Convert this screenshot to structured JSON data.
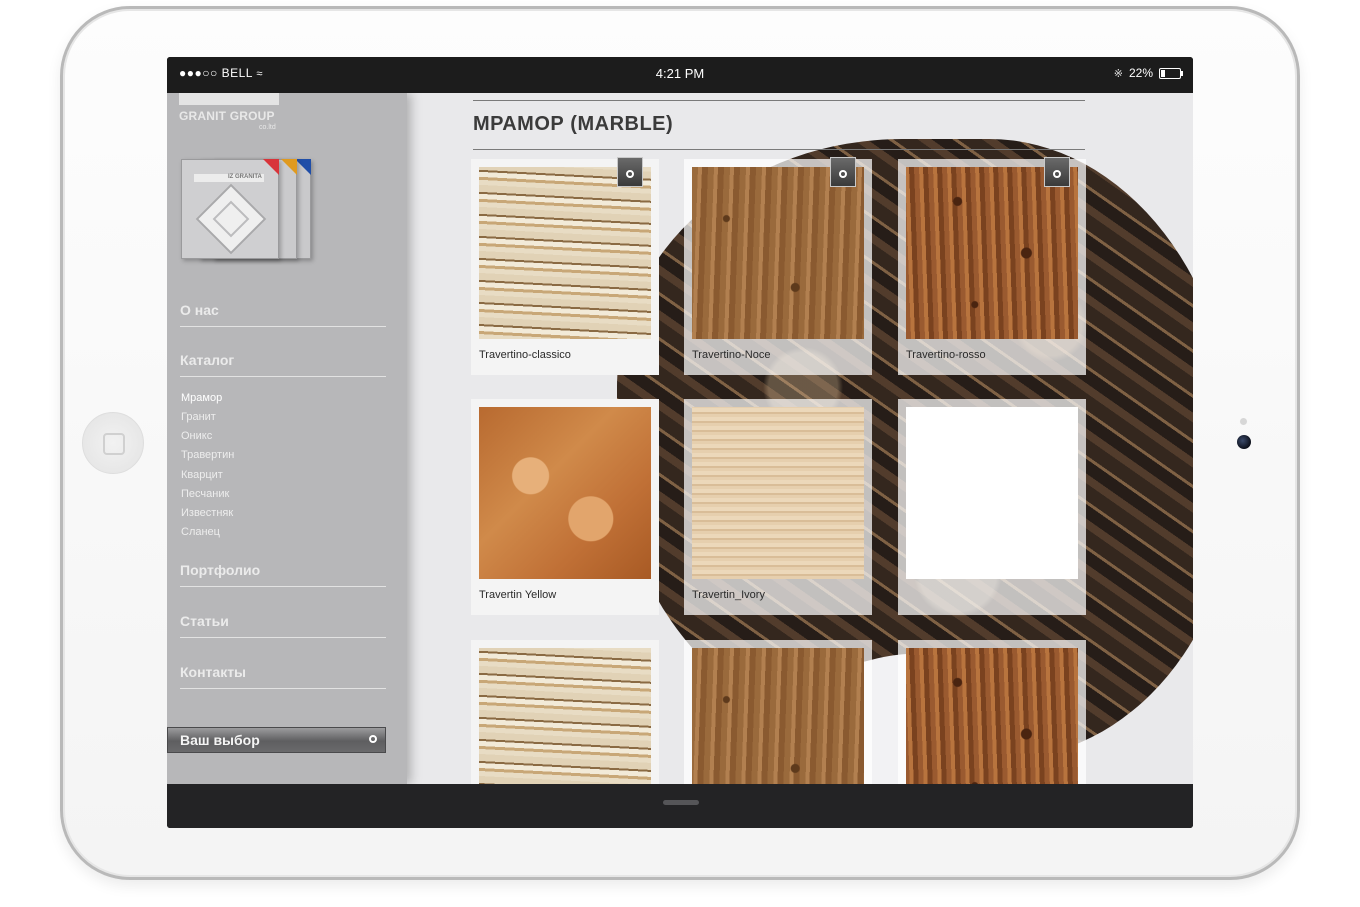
{
  "statusbar": {
    "carrier": "●●●○○ BELL",
    "time": "4:21 PM",
    "battery": "22%",
    "battery_level": 0.22
  },
  "brand": {
    "name": "GRANIT GROUP",
    "suffix": "co.ltd",
    "book_label": "IZ GRANITA"
  },
  "sidebar": {
    "nav": [
      {
        "label": "О нас"
      },
      {
        "label": "Каталог"
      },
      {
        "label": "Портфолио"
      },
      {
        "label": "Статьи"
      },
      {
        "label": "Контакты"
      }
    ],
    "catalog_items": [
      {
        "label": "Мрамор",
        "active": true
      },
      {
        "label": "Гранит"
      },
      {
        "label": "Оникс"
      },
      {
        "label": "Травертин"
      },
      {
        "label": "Кварцит"
      },
      {
        "label": "Песчаник"
      },
      {
        "label": "Известняк"
      },
      {
        "label": "Сланец"
      }
    ],
    "choice_label": "Ваш выбор"
  },
  "main": {
    "title": "МРАМОР (MARBLE)",
    "products": [
      {
        "name": "Travertino-classico",
        "swatch": "classico"
      },
      {
        "name": "Travertino-Noce",
        "swatch": "noce"
      },
      {
        "name": "Travertino-rosso",
        "swatch": "rosso"
      },
      {
        "name": "Travertin Yellow",
        "swatch": "yellow"
      },
      {
        "name": "Travertin_Ivory",
        "swatch": "ivory"
      },
      {
        "name": "",
        "swatch": "blank"
      },
      {
        "name": "",
        "swatch": "classico"
      },
      {
        "name": "",
        "swatch": "noce"
      },
      {
        "name": "",
        "swatch": "rosso"
      }
    ]
  },
  "colors": {
    "sidebar_bg": "#b7b7b9",
    "statusbar_bg": "#1c1c1c",
    "content_bg": "#e9e9eb",
    "title_text": "#3b3b3b"
  }
}
